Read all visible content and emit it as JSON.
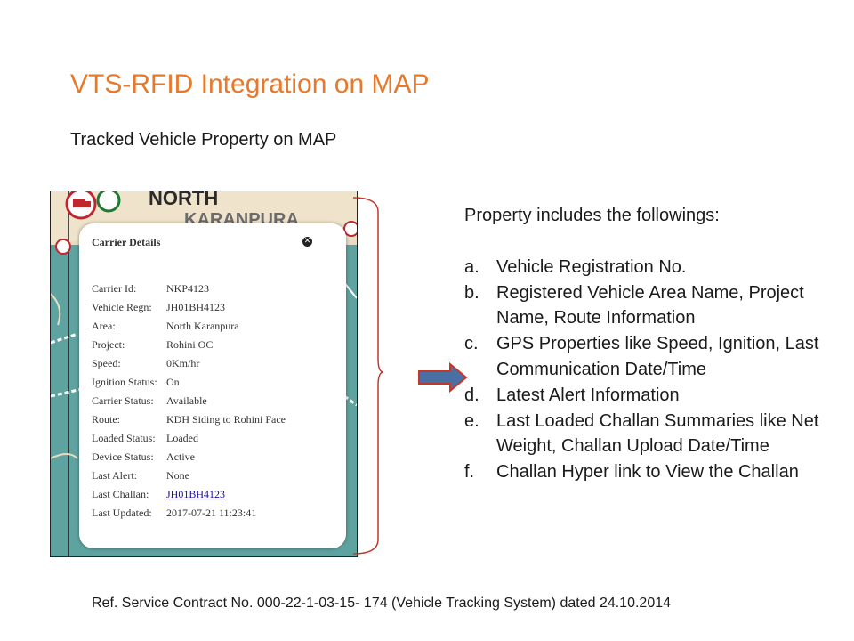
{
  "slide": {
    "title": "VTS-RFID Integration on MAP",
    "subtitle": "Tracked Vehicle Property on MAP",
    "colors": {
      "title": "#e8782a",
      "text": "#1a1a1a",
      "bracket": "#c0392b",
      "arrow_fill": "#4a6fa5",
      "arrow_stroke": "#c0392b"
    }
  },
  "map": {
    "labels": [
      "NORTH",
      "KARANPURA"
    ],
    "popup": {
      "title": "Carrier Details",
      "close_icon": "close-icon",
      "rows": [
        {
          "label": "Carrier Id:",
          "value": "NKP4123"
        },
        {
          "label": "Vehicle Regn:",
          "value": "JH01BH4123"
        },
        {
          "label": "Area:",
          "value": "North Karanpura"
        },
        {
          "label": "Project:",
          "value": "Rohini OC"
        },
        {
          "label": "Speed:",
          "value": "0Km/hr"
        },
        {
          "label": "Ignition Status:",
          "value": "On"
        },
        {
          "label": "Carrier Status:",
          "value": "Available"
        },
        {
          "label": "Route:",
          "value": "KDH Siding to Rohini Face"
        },
        {
          "label": "Loaded Status:",
          "value": "Loaded"
        },
        {
          "label": "Device Status:",
          "value": "Active"
        },
        {
          "label": "Last Alert:",
          "value": "None"
        },
        {
          "label": "Last Challan:",
          "value": "JH01BH4123"
        },
        {
          "label": "Last Updated:",
          "value": "2017-07-21 11:23:41"
        }
      ]
    }
  },
  "properties": {
    "heading": "Property includes the followings:",
    "items": [
      {
        "marker": "a.",
        "text": "Vehicle Registration No."
      },
      {
        "marker": "b.",
        "text": "Registered Vehicle Area Name, Project Name, Route Information"
      },
      {
        "marker": "c.",
        "text": "GPS Properties like Speed, Ignition, Last Communication Date/Time"
      },
      {
        "marker": "d.",
        "text": "Latest Alert Information"
      },
      {
        "marker": "e.",
        "text": "Last Loaded Challan Summaries like Net Weight, Challan Upload Date/Time"
      },
      {
        "marker": "f.",
        "text": "Challan Hyper link to View the Challan"
      }
    ]
  },
  "reference": "Ref. Service Contract No. 000-22-1-03-15- 174 (Vehicle Tracking System)  dated 24.10.2014"
}
